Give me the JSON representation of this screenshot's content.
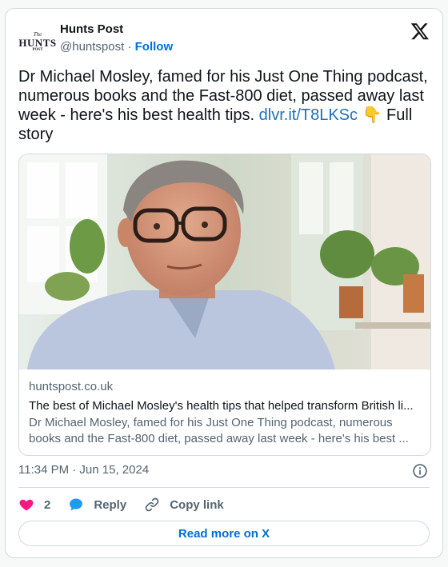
{
  "author": {
    "name": "Hunts Post",
    "handle": "@huntspost",
    "separator": "·",
    "follow_label": "Follow",
    "avatar": {
      "line1": "The",
      "line2": "HUNTS",
      "line3": "POST"
    }
  },
  "tweet": {
    "text_before_link": "Dr Michael Mosley, famed for his Just One Thing podcast, numerous books and the Fast-800 diet, passed away last week - here's his best health tips. ",
    "link_text": "dlvr.it/T8LKSc",
    "emoji": "👇",
    "text_after": " Full story"
  },
  "link_card": {
    "domain": "huntspost.co.uk",
    "title": "The best of Michael Mosley's health tips that helped transform British li...",
    "description": "Dr Michael Mosley, famed for his Just One Thing podcast, numerous books and the Fast-800 diet, passed away last week - here's his best ..."
  },
  "timestamp": "11:34 PM · Jun 15, 2024",
  "actions": {
    "like_count": "2",
    "reply_label": "Reply",
    "copy_label": "Copy link"
  },
  "read_more_label": "Read more on X",
  "colors": {
    "like": "#f91880",
    "reply": "#1d9bf0",
    "link": "#006fd6",
    "muted": "#536471"
  },
  "icons": [
    "x-logo-icon",
    "info-icon",
    "heart-icon",
    "reply-bubble-icon",
    "link-icon"
  ]
}
